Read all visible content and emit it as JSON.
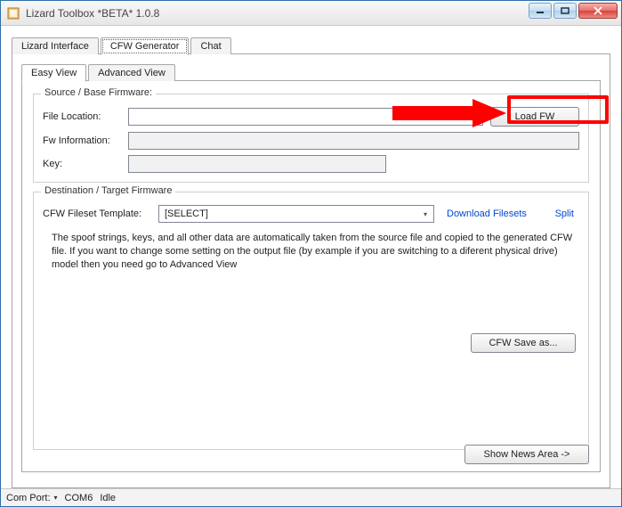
{
  "window": {
    "title": "Lizard Toolbox *BETA* 1.0.8"
  },
  "mainTabs": {
    "items": [
      "Lizard Interface",
      "CFW Generator",
      "Chat"
    ],
    "activeIndex": 1
  },
  "subTabs": {
    "items": [
      "Easy View",
      "Advanced View"
    ],
    "activeIndex": 0
  },
  "source": {
    "legend": "Source / Base Firmware:",
    "fileLocationLabel": "File Location:",
    "fileLocationValue": "",
    "fwInfoLabel": "Fw Information:",
    "fwInfoValue": "",
    "keyLabel": "Key:",
    "keyValue": "",
    "loadButton": "Load FW"
  },
  "destination": {
    "legend": "Destination / Target Firmware",
    "templateLabel": "CFW Fileset Template:",
    "templateSelected": "[SELECT]",
    "downloadLink": "Download Filesets",
    "splitLink": "Split",
    "info": "The spoof strings, keys, and all other data are automatically taken from the source file and copied to the generated CFW file.  If you want to change some setting on the output file (by example if you are switching to a diferent physical drive) model then you need go to Advanced View",
    "saveButton": "CFW Save as..."
  },
  "footer": {
    "showNewsButton": "Show News Area ->"
  },
  "status": {
    "comPortLabel": "Com Port:",
    "comPortValue": "COM6",
    "state": "Idle"
  }
}
